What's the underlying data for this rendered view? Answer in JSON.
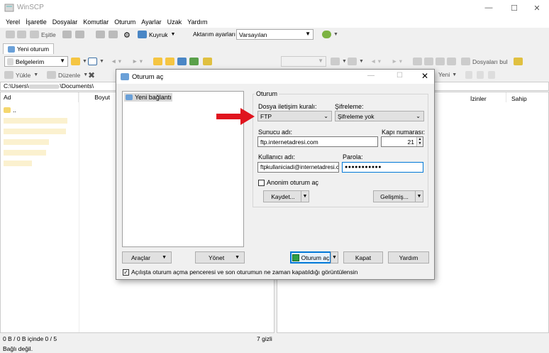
{
  "app": {
    "title": "WinSCP"
  },
  "menu": [
    "Yerel",
    "İşaretle",
    "Dosyalar",
    "Komutlar",
    "Oturum",
    "Ayarlar",
    "Uzak",
    "Yardım"
  ],
  "toolbar": {
    "synchronize": "Eşitle",
    "queue": "Kuyruk",
    "transfer_settings_label": "Aktarım ayarları",
    "transfer_settings_value": "Varsayılan"
  },
  "tabs": {
    "new_session": "Yeni oturum"
  },
  "local": {
    "location": "Belgelerim",
    "upload": "Yükle",
    "edit": "Düzenle",
    "path": "C:\\Users\\",
    "path_suffix": "\\Documents\\",
    "columns": {
      "name": "Ad",
      "size": "Boyut"
    },
    "parent_dir": "..",
    "status_selection": "0 B / 0 B içinde 0 / 5",
    "status_hidden": "7 gizli"
  },
  "remote": {
    "find_files": "Dosyaları bul",
    "new": "Yeni",
    "columns": {
      "permissions": "İzinler",
      "owner": "Sahip"
    }
  },
  "status": {
    "connection": "Bağlı değil."
  },
  "dialog": {
    "title": "Oturum aç",
    "tree_item": "Yeni bağlantı",
    "group_title": "Oturum",
    "protocol_label": "Dosya iletişim kuralı:",
    "protocol_value": "FTP",
    "encryption_label": "Şifreleme:",
    "encryption_value": "Şifreleme yok",
    "host_label": "Sunucu adı:",
    "host_value": "ftp.internetadresi.com",
    "port_label": "Kapı numarası:",
    "port_value": "21",
    "user_label": "Kullanıcı adı:",
    "user_value": "ftpkullaniciadi@internetadresi.co",
    "password_label": "Parola:",
    "password_value": "●●●●●●●●●●●",
    "anonymous_label": "Anonim oturum aç",
    "save_button": "Kaydet...",
    "advanced_button": "Gelişmiş...",
    "tools_button": "Araçlar",
    "manage_button": "Yönet",
    "login_button": "Oturum aç",
    "close_button": "Kapat",
    "help_button": "Yardım",
    "startup_checkbox": "Açılışta oturum açma penceresi ve son oturumun ne zaman kapatıldığı görüntülensin"
  },
  "colors": {
    "accent": "#0078d7",
    "arrow": "#e0141e",
    "folder": "#f5d76e"
  }
}
